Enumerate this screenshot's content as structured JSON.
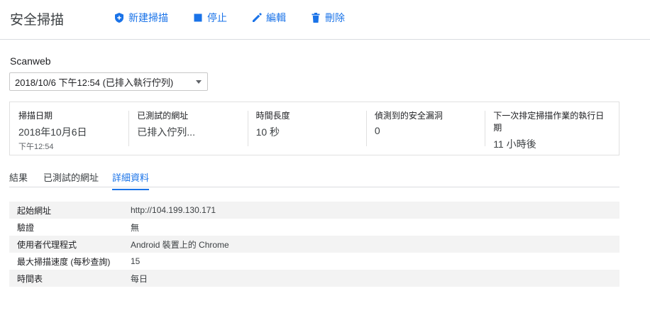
{
  "header": {
    "title": "安全掃描",
    "actions": {
      "new_scan": "新建掃描",
      "stop": "停止",
      "edit": "編輯",
      "delete": "刪除"
    }
  },
  "scan": {
    "name": "Scanweb",
    "selected_run": "2018/10/6 下午12:54 (已排入執行佇列)"
  },
  "summary": [
    {
      "label": "掃描日期",
      "value": "2018年10月6日",
      "sub": "下午12:54"
    },
    {
      "label": "已測試的網址",
      "value": "已排入佇列...",
      "sub": ""
    },
    {
      "label": "時間長度",
      "value": "10 秒",
      "sub": ""
    },
    {
      "label": "偵測到的安全漏洞",
      "value": "0",
      "sub": ""
    },
    {
      "label": "下一次排定掃描作業的執行日期",
      "value": "11 小時後",
      "sub": ""
    }
  ],
  "tabs": [
    "結果",
    "已測試的網址",
    "詳細資料"
  ],
  "details": [
    {
      "key": "起始網址",
      "value": "http://104.199.130.171"
    },
    {
      "key": "驗證",
      "value": "無"
    },
    {
      "key": "使用者代理程式",
      "value": "Android 裝置上的 Chrome"
    },
    {
      "key": "最大掃描速度 (每秒查詢)",
      "value": "15"
    },
    {
      "key": "時間表",
      "value": "每日"
    }
  ],
  "colors": {
    "accent": "#1a73e8",
    "border": "#dadce0",
    "row_alt": "#f3f3f3"
  }
}
